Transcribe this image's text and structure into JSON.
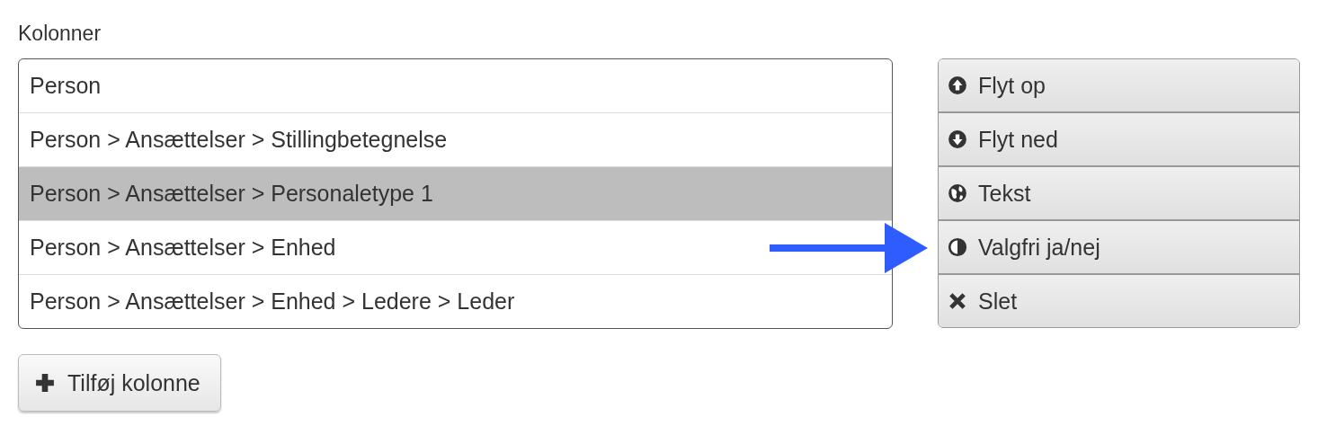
{
  "label": "Kolonner",
  "columns": [
    {
      "text": "Person",
      "selected": false
    },
    {
      "text": "Person > Ansættelser > Stillingbetegnelse",
      "selected": false
    },
    {
      "text": "Person > Ansættelser > Personaletype 1",
      "selected": true
    },
    {
      "text": "Person > Ansættelser > Enhed",
      "selected": false
    },
    {
      "text": "Person > Ansættelser > Enhed > Ledere > Leder",
      "selected": false
    }
  ],
  "actions": [
    {
      "kind": "up",
      "label": "Flyt op"
    },
    {
      "kind": "down",
      "label": "Flyt ned"
    },
    {
      "kind": "globe",
      "label": "Tekst"
    },
    {
      "kind": "toggle",
      "label": "Valgfri ja/nej"
    },
    {
      "kind": "remove",
      "label": "Slet"
    }
  ],
  "add_button": {
    "label": "Tilføj kolonne"
  }
}
